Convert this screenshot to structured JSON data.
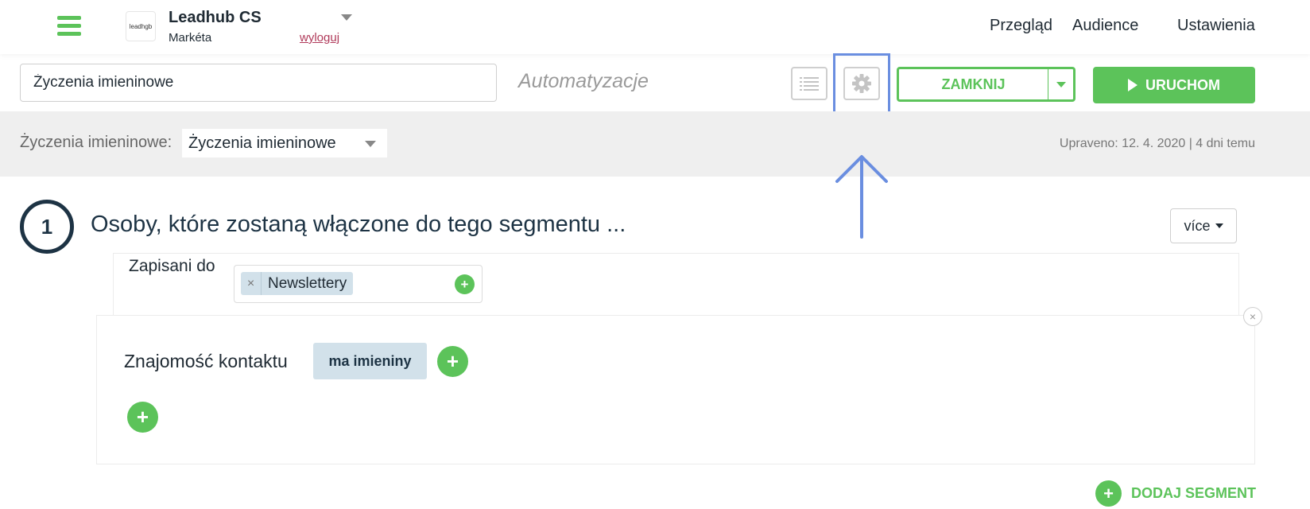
{
  "header": {
    "account_name": "Leadhub CS",
    "account_user": "Markéta",
    "logout_label": "wyloguj",
    "logo_text": "leadhgb",
    "nav": [
      "Przegląd",
      "Audience",
      "Ustawienia"
    ]
  },
  "toolbar": {
    "name_value": "Życzenia imieninowe",
    "section_label": "Automatyzacje",
    "close_label": "ZAMKNIJ",
    "run_label": "URUCHOM"
  },
  "band": {
    "label": "Życzenia imieninowe:",
    "selected": "Życzenia imieninowe",
    "modified": "Upraveno: 12. 4. 2020 | 4 dni temu"
  },
  "segment": {
    "step": "1",
    "title": "Osoby, które zostaną włączone do tego segmentu ...",
    "more_label": "více",
    "subscribed_label": "Zapisani do",
    "tag": "Newslettery",
    "condition_label": "Znajomość kontaktu",
    "condition_chip": "ma imieniny",
    "add_segment_label": "DODAJ SEGMENT"
  },
  "colors": {
    "green": "#5cc35a",
    "highlight": "#6a8ee0",
    "dark": "#1d3344",
    "chip": "#d2e1ea"
  }
}
